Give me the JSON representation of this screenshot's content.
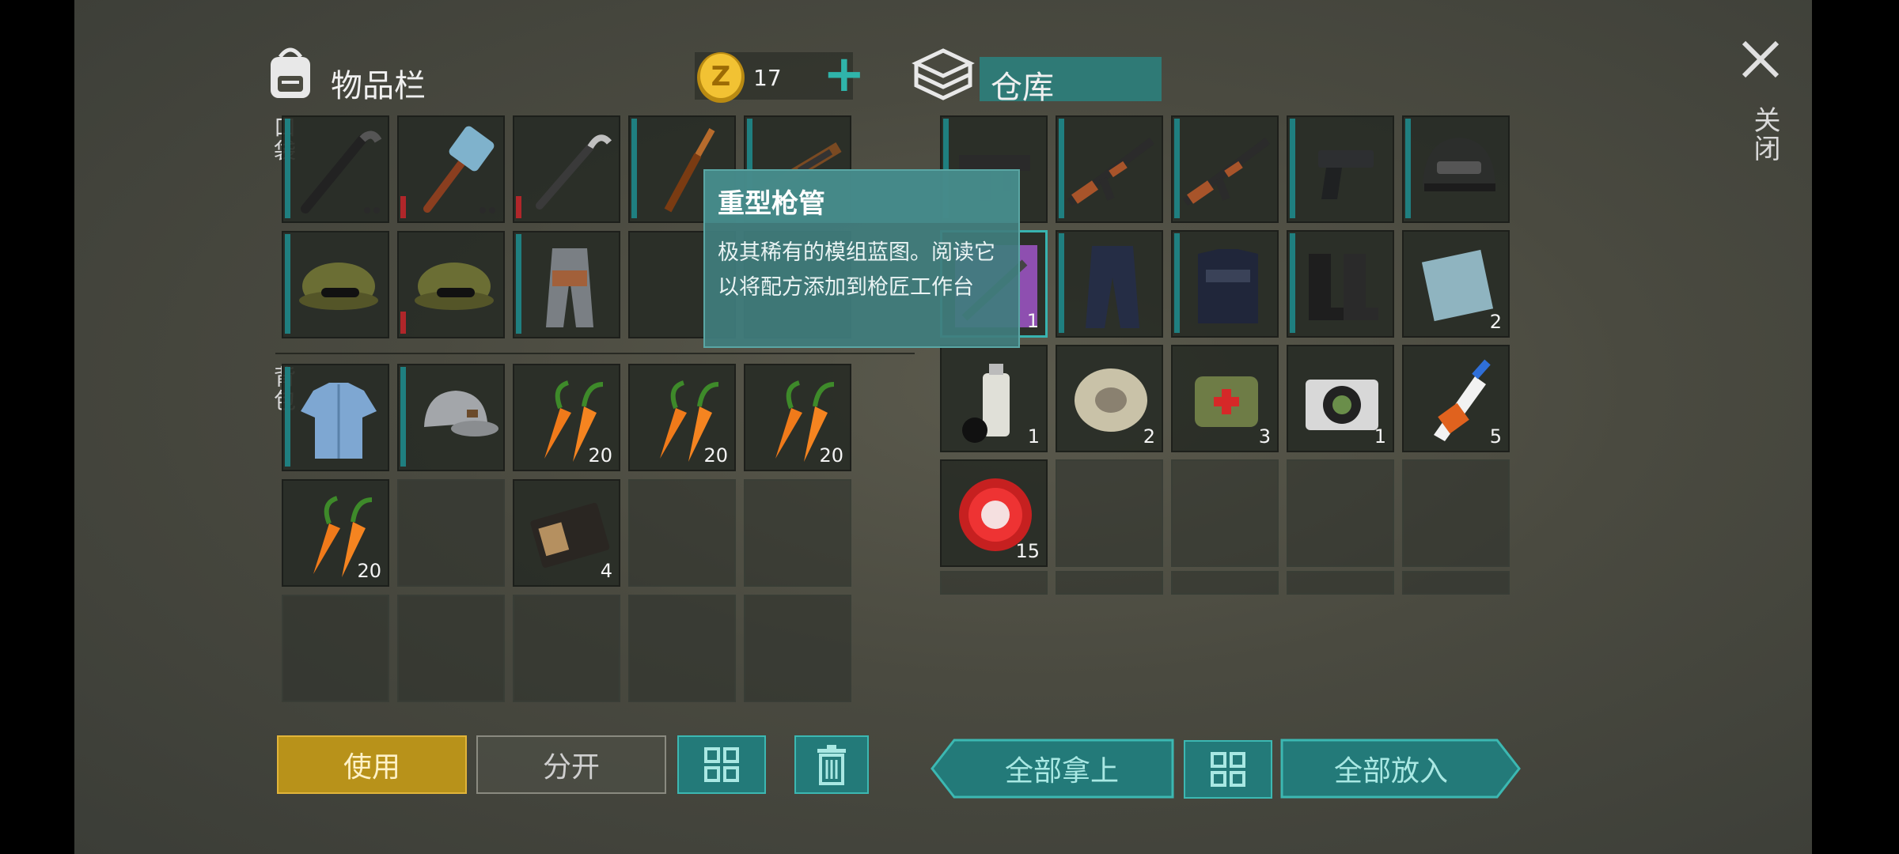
{
  "inventory": {
    "title": "物品栏",
    "pocket_label": "口袋",
    "backpack_label": "背包",
    "coins": "17",
    "add_symbol": "+",
    "pocket_slots": [
      {
        "item": "crowbar",
        "dur": "teal",
        "dots": [
          0,
          0
        ],
        "count": ""
      },
      {
        "item": "sledgehammer",
        "dur": "red",
        "dots": [
          0,
          0
        ],
        "count": ""
      },
      {
        "item": "crowbar-2",
        "dur": "red",
        "count": ""
      },
      {
        "item": "knife",
        "dur": "teal",
        "count": ""
      },
      {
        "item": "rifle",
        "dur": "teal",
        "count": ""
      },
      {
        "item": "camo-cap",
        "dur": "teal",
        "count": ""
      },
      {
        "item": "camo-cap",
        "dur": "red",
        "count": ""
      },
      {
        "item": "pants",
        "dur": "teal",
        "count": ""
      },
      {
        "item": "hidden",
        "count": ""
      },
      {
        "item": "hidden",
        "count": ""
      }
    ],
    "backpack_slots": [
      {
        "item": "shirt",
        "dur": "teal",
        "count": ""
      },
      {
        "item": "cap",
        "dur": "teal",
        "count": ""
      },
      {
        "item": "carrot",
        "count": "20"
      },
      {
        "item": "carrot",
        "count": "20"
      },
      {
        "item": "carrot",
        "count": "20"
      },
      {
        "item": "carrot",
        "count": "20"
      },
      {
        "item": "empty",
        "count": ""
      },
      {
        "item": "wallet",
        "count": "4"
      },
      {
        "item": "empty",
        "count": ""
      },
      {
        "item": "empty",
        "count": ""
      }
    ],
    "use_label": "使用",
    "split_label": "分开"
  },
  "storage": {
    "title": "仓库",
    "slots": [
      {
        "item": "smg",
        "dur": "teal",
        "count": ""
      },
      {
        "item": "ak",
        "dur": "teal",
        "count": ""
      },
      {
        "item": "ak",
        "dur": "teal",
        "count": ""
      },
      {
        "item": "pistol",
        "dur": "teal",
        "count": ""
      },
      {
        "item": "helmet",
        "dur": "teal",
        "count": ""
      },
      {
        "item": "blueprint",
        "count": "1",
        "selected": true
      },
      {
        "item": "police-pants",
        "dur": "teal",
        "count": ""
      },
      {
        "item": "vest",
        "dur": "teal",
        "count": ""
      },
      {
        "item": "boots",
        "dur": "teal",
        "count": ""
      },
      {
        "item": "steel-plate",
        "count": "2"
      },
      {
        "item": "spray-paint",
        "count": "1"
      },
      {
        "item": "wire",
        "count": "2"
      },
      {
        "item": "medkit-bag",
        "count": "3"
      },
      {
        "item": "camera",
        "count": "1"
      },
      {
        "item": "glue",
        "count": "5"
      },
      {
        "item": "bottle-cap",
        "count": "15"
      }
    ],
    "take_all_label": "全部拿上",
    "put_all_label": "全部放入"
  },
  "close_label": "关闭",
  "tooltip": {
    "title": "重型枪管",
    "body": "极其稀有的模组蓝图。阅读它以将配方添加到枪匠工作台"
  },
  "colors": {
    "teal": "#237a79",
    "gold_button": "#b8921a",
    "durability_red": "#b0262a"
  }
}
